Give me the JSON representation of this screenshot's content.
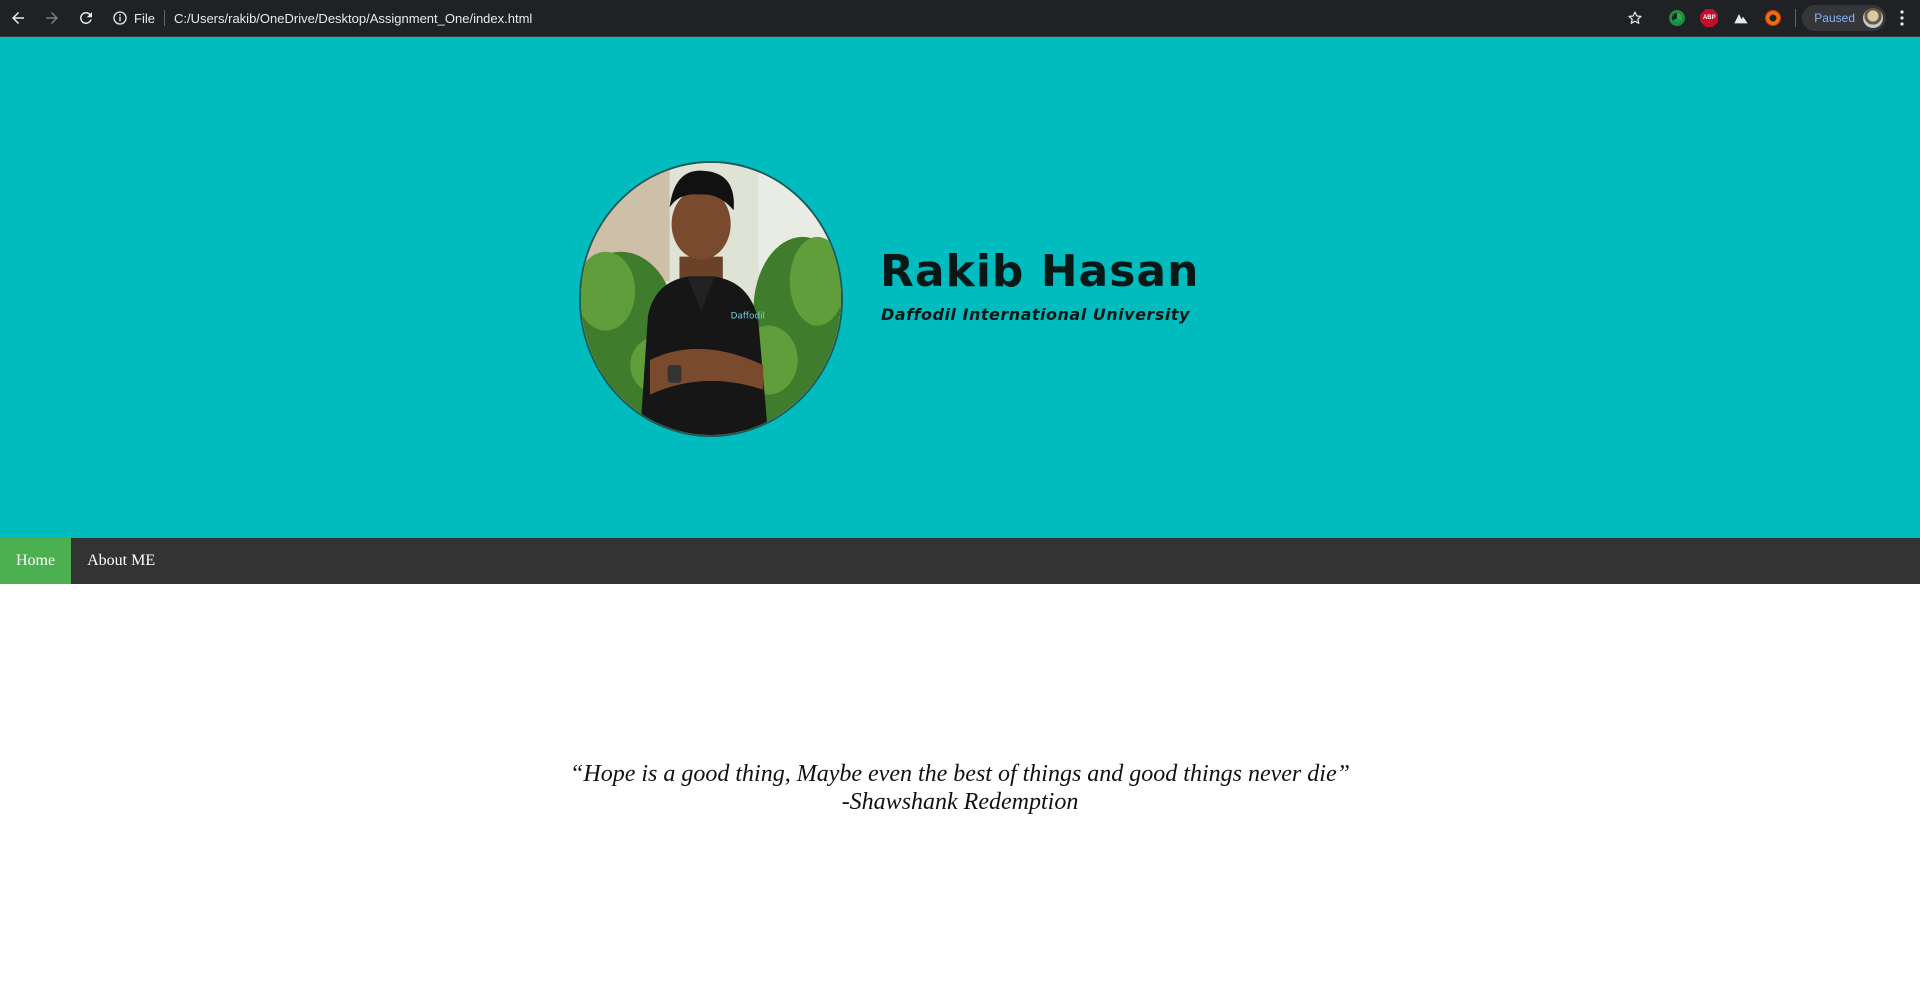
{
  "browser": {
    "scheme_label": "File",
    "url": "C:/Users/rakib/OneDrive/Desktop/Assignment_One/index.html",
    "profile_status": "Paused",
    "extensions": [
      "chrome-green-ext-icon",
      "adblock-plus-icon",
      "mountain-ext-icon",
      "orange-ring-ext-icon"
    ],
    "abp_label": "ABP"
  },
  "header": {
    "background_color": "#00bcbf",
    "name": "Rakib Hasan",
    "university": "Daffodil International University",
    "photo_icon": "profile-photo"
  },
  "nav": {
    "items": [
      {
        "label": "Home",
        "active": true
      },
      {
        "label": "About ME",
        "active": false
      }
    ],
    "active_color": "#4caf50",
    "background_color": "#333333"
  },
  "quote": {
    "text": "“Hope is a good thing, Maybe even the best of things and good things never die”",
    "attribution": "-Shawshank Redemption"
  }
}
